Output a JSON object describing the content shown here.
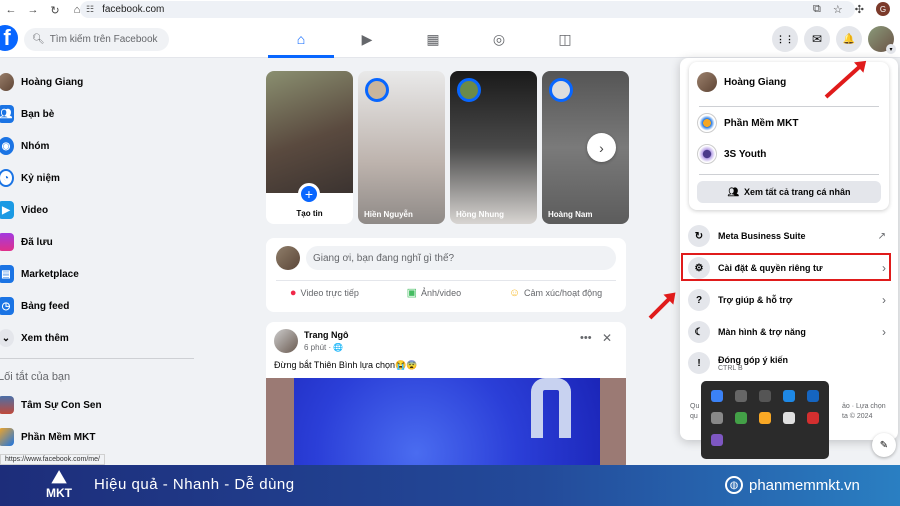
{
  "browser": {
    "url": "facebook.com",
    "profile_initial": "G"
  },
  "header": {
    "search_placeholder": "Tìm kiếm trên Facebook",
    "tabs": [
      {
        "name": "home",
        "icon": "⌂"
      },
      {
        "name": "video",
        "icon": "▶"
      },
      {
        "name": "marketplace",
        "icon": "▦"
      },
      {
        "name": "groups",
        "icon": "◎"
      },
      {
        "name": "gaming",
        "icon": "◫"
      }
    ],
    "menu_icon": "⋮⋮",
    "messenger_icon": "✉",
    "notifications_icon": "🔔"
  },
  "sidebar": {
    "items": [
      {
        "label": "Hoàng Giang",
        "icon": "avatar",
        "color": "#8c6d5a"
      },
      {
        "label": "Bạn bè",
        "icon": "friends-icon",
        "color": "#1b74e4"
      },
      {
        "label": "Nhóm",
        "icon": "groups-icon",
        "color": "#1b74e4"
      },
      {
        "label": "Kỷ niệm",
        "icon": "memories-icon",
        "color": "#1b74e4"
      },
      {
        "label": "Video",
        "icon": "video-icon",
        "color": "#1b9ae4"
      },
      {
        "label": "Đã lưu",
        "icon": "saved-icon",
        "color": "#a33ae0"
      },
      {
        "label": "Marketplace",
        "icon": "marketplace-icon",
        "color": "#1b74e4"
      },
      {
        "label": "Bảng feed",
        "icon": "feeds-icon",
        "color": "#1b74e4"
      },
      {
        "label": "Xem thêm",
        "icon": "chevron-down-icon",
        "color": "#e4e6eb"
      }
    ],
    "shortcuts_heading": "Lối tắt của bạn",
    "shortcuts": [
      {
        "label": "Tâm Sự Con Sen"
      },
      {
        "label": "Phần Mềm MKT"
      }
    ],
    "status_url": "https://www.facebook.com/me/"
  },
  "stories": {
    "create_label": "Tạo tin",
    "items": [
      {
        "name": "Hiền Nguyễn"
      },
      {
        "name": "Hồng Nhung"
      },
      {
        "name": "Hoàng Nam"
      }
    ]
  },
  "composer": {
    "placeholder": "Giang ơi, bạn đang nghĩ gì thế?",
    "actions": [
      {
        "label": "Video trực tiếp",
        "icon": "●",
        "color": "#f02849"
      },
      {
        "label": "Ảnh/video",
        "icon": "▣",
        "color": "#45bd62"
      },
      {
        "label": "Cảm xúc/hoạt động",
        "icon": "☺",
        "color": "#f7b928"
      }
    ]
  },
  "post": {
    "author": "Trang Ngô",
    "time": "6 phút · 🌐",
    "text": "Đừng bắt Thiên Bình lựa chọn😭😨"
  },
  "account_menu": {
    "profile_name": "Hoàng Giang",
    "pages": [
      {
        "name": "Phần Mềm MKT"
      },
      {
        "name": "3S Youth"
      }
    ],
    "see_all_profiles": "Xem tất cả trang cá nhân",
    "items": [
      {
        "label": "Meta Business Suite",
        "icon": "↻",
        "trail": "↗"
      },
      {
        "label": "Cài đặt & quyền riêng tư",
        "icon": "⚙",
        "trail": "›"
      },
      {
        "label": "Trợ giúp & hỗ trợ",
        "icon": "?",
        "trail": "›"
      },
      {
        "label": "Màn hình & trợ năng",
        "icon": "☾",
        "trail": "›"
      },
      {
        "label": "Đóng góp ý kiến",
        "icon": "!",
        "sub": "CTRL B"
      }
    ],
    "footer_left": "Qu\nqu",
    "footer_right": "ảo · Lựa chọn\nta © 2024"
  },
  "tray_icon_colors": [
    "#3b82f6",
    "#666666",
    "#555555",
    "#1e88e5",
    "#1565c0",
    "#888888",
    "#43a047",
    "#f9a825",
    "#e0e0e0",
    "#d32f2f",
    "#7e57c2"
  ],
  "banner": {
    "logo_text": "MKT",
    "slogan": "Hiệu quả - Nhanh - Dễ dùng",
    "website": "phanmemmkt.vn"
  }
}
